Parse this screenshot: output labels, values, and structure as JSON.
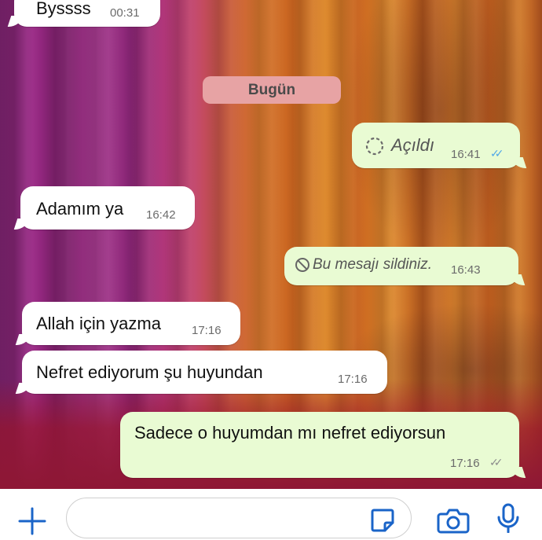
{
  "messages": [
    {
      "text": "Byssss",
      "time": "00:31",
      "dir": "in"
    },
    {
      "text": "Açıldı",
      "time": "16:41",
      "dir": "out",
      "status": "read",
      "type": "view-once-opened"
    },
    {
      "text": "Adamım ya",
      "time": "16:42",
      "dir": "in"
    },
    {
      "text": "Bu mesajı sildiniz.",
      "time": "16:43",
      "dir": "out",
      "type": "deleted"
    },
    {
      "text": "Allah için yazma",
      "time": "17:16",
      "dir": "in"
    },
    {
      "text": "Nefret ediyorum şu huyundan",
      "time": "17:16",
      "dir": "in"
    },
    {
      "text": "Sadece o huyumdan mı nefret ediyorsun",
      "time": "17:16",
      "dir": "out",
      "status": "delivered"
    }
  ],
  "date_separator": "Bugün",
  "composer": {
    "icons": [
      "plus-icon",
      "sticker-icon",
      "camera-icon",
      "microphone-icon"
    ],
    "accent_color": "#1a64c8"
  },
  "colors": {
    "incoming_bubble": "#ffffff",
    "outgoing_bubble": "#e9fbd3",
    "read_ticks": "#4fa7e8",
    "date_pill": "#e7a3a4"
  }
}
